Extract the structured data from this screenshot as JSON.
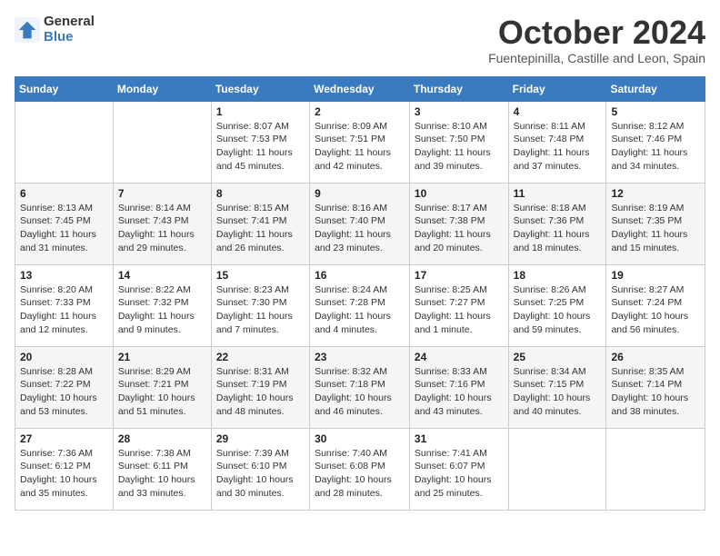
{
  "logo": {
    "general": "General",
    "blue": "Blue"
  },
  "title": "October 2024",
  "subtitle": "Fuentepinilla, Castille and Leon, Spain",
  "days_header": [
    "Sunday",
    "Monday",
    "Tuesday",
    "Wednesday",
    "Thursday",
    "Friday",
    "Saturday"
  ],
  "weeks": [
    [
      {
        "num": "",
        "sunrise": "",
        "sunset": "",
        "daylight": ""
      },
      {
        "num": "",
        "sunrise": "",
        "sunset": "",
        "daylight": ""
      },
      {
        "num": "1",
        "sunrise": "Sunrise: 8:07 AM",
        "sunset": "Sunset: 7:53 PM",
        "daylight": "Daylight: 11 hours and 45 minutes."
      },
      {
        "num": "2",
        "sunrise": "Sunrise: 8:09 AM",
        "sunset": "Sunset: 7:51 PM",
        "daylight": "Daylight: 11 hours and 42 minutes."
      },
      {
        "num": "3",
        "sunrise": "Sunrise: 8:10 AM",
        "sunset": "Sunset: 7:50 PM",
        "daylight": "Daylight: 11 hours and 39 minutes."
      },
      {
        "num": "4",
        "sunrise": "Sunrise: 8:11 AM",
        "sunset": "Sunset: 7:48 PM",
        "daylight": "Daylight: 11 hours and 37 minutes."
      },
      {
        "num": "5",
        "sunrise": "Sunrise: 8:12 AM",
        "sunset": "Sunset: 7:46 PM",
        "daylight": "Daylight: 11 hours and 34 minutes."
      }
    ],
    [
      {
        "num": "6",
        "sunrise": "Sunrise: 8:13 AM",
        "sunset": "Sunset: 7:45 PM",
        "daylight": "Daylight: 11 hours and 31 minutes."
      },
      {
        "num": "7",
        "sunrise": "Sunrise: 8:14 AM",
        "sunset": "Sunset: 7:43 PM",
        "daylight": "Daylight: 11 hours and 29 minutes."
      },
      {
        "num": "8",
        "sunrise": "Sunrise: 8:15 AM",
        "sunset": "Sunset: 7:41 PM",
        "daylight": "Daylight: 11 hours and 26 minutes."
      },
      {
        "num": "9",
        "sunrise": "Sunrise: 8:16 AM",
        "sunset": "Sunset: 7:40 PM",
        "daylight": "Daylight: 11 hours and 23 minutes."
      },
      {
        "num": "10",
        "sunrise": "Sunrise: 8:17 AM",
        "sunset": "Sunset: 7:38 PM",
        "daylight": "Daylight: 11 hours and 20 minutes."
      },
      {
        "num": "11",
        "sunrise": "Sunrise: 8:18 AM",
        "sunset": "Sunset: 7:36 PM",
        "daylight": "Daylight: 11 hours and 18 minutes."
      },
      {
        "num": "12",
        "sunrise": "Sunrise: 8:19 AM",
        "sunset": "Sunset: 7:35 PM",
        "daylight": "Daylight: 11 hours and 15 minutes."
      }
    ],
    [
      {
        "num": "13",
        "sunrise": "Sunrise: 8:20 AM",
        "sunset": "Sunset: 7:33 PM",
        "daylight": "Daylight: 11 hours and 12 minutes."
      },
      {
        "num": "14",
        "sunrise": "Sunrise: 8:22 AM",
        "sunset": "Sunset: 7:32 PM",
        "daylight": "Daylight: 11 hours and 9 minutes."
      },
      {
        "num": "15",
        "sunrise": "Sunrise: 8:23 AM",
        "sunset": "Sunset: 7:30 PM",
        "daylight": "Daylight: 11 hours and 7 minutes."
      },
      {
        "num": "16",
        "sunrise": "Sunrise: 8:24 AM",
        "sunset": "Sunset: 7:28 PM",
        "daylight": "Daylight: 11 hours and 4 minutes."
      },
      {
        "num": "17",
        "sunrise": "Sunrise: 8:25 AM",
        "sunset": "Sunset: 7:27 PM",
        "daylight": "Daylight: 11 hours and 1 minute."
      },
      {
        "num": "18",
        "sunrise": "Sunrise: 8:26 AM",
        "sunset": "Sunset: 7:25 PM",
        "daylight": "Daylight: 10 hours and 59 minutes."
      },
      {
        "num": "19",
        "sunrise": "Sunrise: 8:27 AM",
        "sunset": "Sunset: 7:24 PM",
        "daylight": "Daylight: 10 hours and 56 minutes."
      }
    ],
    [
      {
        "num": "20",
        "sunrise": "Sunrise: 8:28 AM",
        "sunset": "Sunset: 7:22 PM",
        "daylight": "Daylight: 10 hours and 53 minutes."
      },
      {
        "num": "21",
        "sunrise": "Sunrise: 8:29 AM",
        "sunset": "Sunset: 7:21 PM",
        "daylight": "Daylight: 10 hours and 51 minutes."
      },
      {
        "num": "22",
        "sunrise": "Sunrise: 8:31 AM",
        "sunset": "Sunset: 7:19 PM",
        "daylight": "Daylight: 10 hours and 48 minutes."
      },
      {
        "num": "23",
        "sunrise": "Sunrise: 8:32 AM",
        "sunset": "Sunset: 7:18 PM",
        "daylight": "Daylight: 10 hours and 46 minutes."
      },
      {
        "num": "24",
        "sunrise": "Sunrise: 8:33 AM",
        "sunset": "Sunset: 7:16 PM",
        "daylight": "Daylight: 10 hours and 43 minutes."
      },
      {
        "num": "25",
        "sunrise": "Sunrise: 8:34 AM",
        "sunset": "Sunset: 7:15 PM",
        "daylight": "Daylight: 10 hours and 40 minutes."
      },
      {
        "num": "26",
        "sunrise": "Sunrise: 8:35 AM",
        "sunset": "Sunset: 7:14 PM",
        "daylight": "Daylight: 10 hours and 38 minutes."
      }
    ],
    [
      {
        "num": "27",
        "sunrise": "Sunrise: 7:36 AM",
        "sunset": "Sunset: 6:12 PM",
        "daylight": "Daylight: 10 hours and 35 minutes."
      },
      {
        "num": "28",
        "sunrise": "Sunrise: 7:38 AM",
        "sunset": "Sunset: 6:11 PM",
        "daylight": "Daylight: 10 hours and 33 minutes."
      },
      {
        "num": "29",
        "sunrise": "Sunrise: 7:39 AM",
        "sunset": "Sunset: 6:10 PM",
        "daylight": "Daylight: 10 hours and 30 minutes."
      },
      {
        "num": "30",
        "sunrise": "Sunrise: 7:40 AM",
        "sunset": "Sunset: 6:08 PM",
        "daylight": "Daylight: 10 hours and 28 minutes."
      },
      {
        "num": "31",
        "sunrise": "Sunrise: 7:41 AM",
        "sunset": "Sunset: 6:07 PM",
        "daylight": "Daylight: 10 hours and 25 minutes."
      },
      {
        "num": "",
        "sunrise": "",
        "sunset": "",
        "daylight": ""
      },
      {
        "num": "",
        "sunrise": "",
        "sunset": "",
        "daylight": ""
      }
    ]
  ]
}
